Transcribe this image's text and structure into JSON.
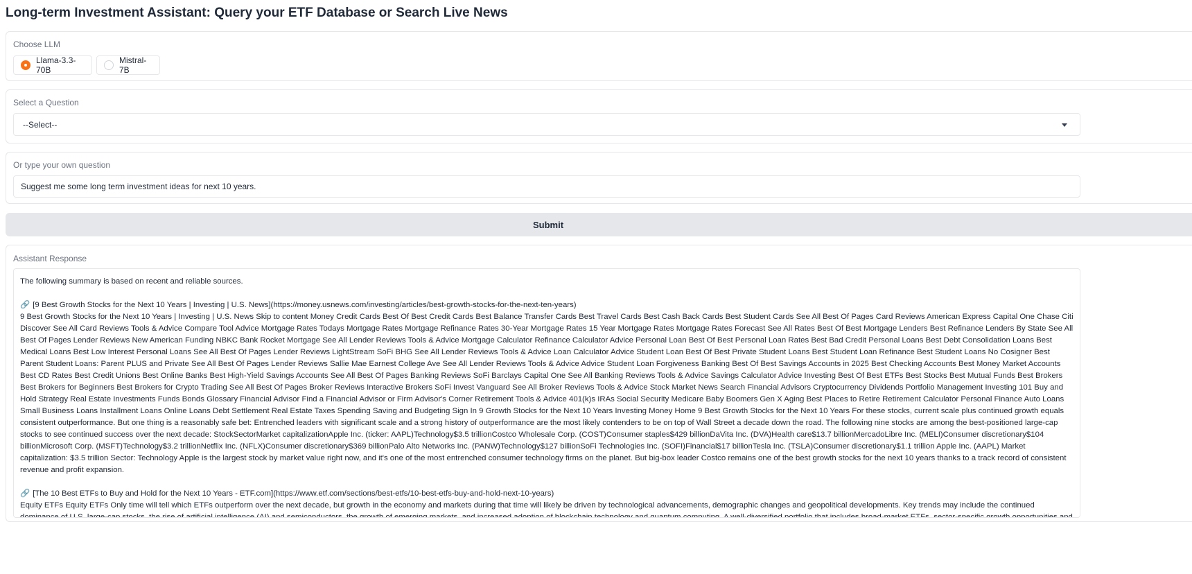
{
  "app": {
    "title": "Long-term Investment Assistant: Query your ETF Database or Search Live News"
  },
  "llm": {
    "label": "Choose LLM",
    "options": [
      {
        "label": "Llama-3.3-70B",
        "selected": true
      },
      {
        "label": "Mistral-7B",
        "selected": false
      }
    ]
  },
  "question_select": {
    "label": "Select a Question",
    "value": "--Select--"
  },
  "own_question": {
    "label": "Or type your own question",
    "value": "Suggest me some long term investment ideas for next 10 years."
  },
  "submit": {
    "label": "Submit"
  },
  "response": {
    "label": "Assistant Response",
    "intro": "The following summary is based on recent and reliable sources.",
    "sources": [
      {
        "icon": "link-icon",
        "title": "[9 Best Growth Stocks for the Next 10 Years | Investing | U.S. News](https://money.usnews.com/investing/articles/best-growth-stocks-for-the-next-ten-years)",
        "body": "9 Best Growth Stocks for the Next 10 Years | Investing | U.S. News Skip to content Money Credit Cards Best Of Best Credit Cards Best Balance Transfer Cards Best Travel Cards Best Cash Back Cards Best Student Cards See All Best Of Pages Card Reviews American Express Capital One Chase Citi Discover See All Card Reviews Tools & Advice Compare Tool Advice Mortgage Rates Todays Mortgage Rates Mortgage Refinance Rates 30-Year Mortgage Rates 15 Year Mortgage Rates Mortgage Rates Forecast See All Rates Best Of Best Mortgage Lenders Best Refinance Lenders By State See All Best Of Pages Lender Reviews New American Funding NBKC Bank Rocket Mortgage See All Lender Reviews Tools & Advice Mortgage Calculator Refinance Calculator Advice Personal Loan Best Of Best Personal Loan Rates Best Bad Credit Personal Loans Best Debt Consolidation Loans Best Medical Loans Best Low Interest Personal Loans See All Best Of Pages Lender Reviews LightStream SoFi BHG See All Lender Reviews Tools & Advice Loan Calculator Advice Student Loan Best Of Best Private Student Loans Best Student Loan Refinance Best Student Loans No Cosigner Best Parent Student Loans: Parent PLUS and Private See All Best Of Pages Lender Reviews Sallie Mae Earnest College Ave See All Lender Reviews Tools & Advice Advice Student Loan Forgiveness Banking Best Of Best Savings Accounts in 2025 Best Checking Accounts Best Money Market Accounts Best CD Rates Best Credit Unions Best Online Banks Best High-Yield Savings Accounts See All Best Of Pages Banking Reviews SoFi Barclays Capital One See All Banking Reviews Tools & Advice Savings Calculator Advice Investing Best Of Best ETFs Best Stocks Best Mutual Funds Best Brokers Best Brokers for Beginners Best Brokers for Crypto Trading See All Best Of Pages Broker Reviews Interactive Brokers SoFi Invest Vanguard See All Broker Reviews Tools & Advice Stock Market News Search Financial Advisors Cryptocurrency Dividends Portfolio Management Investing 101 Buy and Hold Strategy Real Estate Investments Funds Bonds Glossary Financial Advisor Find a Financial Advisor or Firm Advisor's Corner Retirement Tools & Advice 401(k)s IRAs Social Security Medicare Baby Boomers Gen X Aging Best Places to Retire Retirement Calculator Personal Finance Auto Loans Small Business Loans Installment Loans Online Loans Debt Settlement Real Estate Taxes Spending Saving and Budgeting Sign In 9 Growth Stocks for the Next 10 Years Investing Money Home 9 Best Growth Stocks for the Next 10 Years For these stocks, current scale plus continued growth equals consistent outperformance. But one thing is a reasonably safe bet: Entrenched leaders with significant scale and a strong history of outperformance are the most likely contenders to be on top of Wall Street a decade down the road. The following nine stocks are among the best-positioned large-cap stocks to see continued success over the next decade: StockSectorMarket capitalizationApple Inc. (ticker: AAPL)Technology$3.5 trillionCostco Wholesale Corp. (COST)Consumer staples$429 billionDaVita Inc. (DVA)Health care$13.7 billionMercadoLibre Inc. (MELI)Consumer discretionary$104 billionMicrosoft Corp. (MSFT)Technology$3.2 trillionNetflix Inc. (NFLX)Consumer discretionary$369 billionPalo Alto Networks Inc. (PANW)Technology$127 billionSoFi Technologies Inc. (SOFI)Financial$17 billionTesla Inc. (TSLA)Consumer discretionary$1.1 trillion Apple Inc. (AAPL) Market capitalization: $3.5 trillion Sector: Technology Apple is the largest stock by market value right now, and it's one of the most entrenched consumer technology firms on the planet. But big-box leader Costco remains one of the best growth stocks for the next 10 years thanks to a track record of consistent revenue and profit expansion."
      },
      {
        "icon": "link-icon",
        "title": "[The 10 Best ETFs to Buy and Hold for the Next 10 Years - ETF.com](https://www.etf.com/sections/best-etfs/10-best-etfs-buy-and-hold-next-10-years)",
        "body": "Equity ETFs Equity ETFs Only time will tell which ETFs outperform over the next decade, but growth in the economy and markets during that time will likely be driven by technological advancements, demographic changes and geopolitical developments. Key trends may include the continued dominance of U.S. large-cap stocks, the rise of artificial intelligence (AI) and semiconductors, the growth of emerging markets, and increased adoption of blockchain technology and quantum computing. A well-diversified portfolio that includes broad-market ETFs, sector-specific growth opportunities and thematic investments can help investors maximize long-term returns while managing risk. | Contact: kent.thune@etf.com Kent Thune is Senior Content Editor for etf.com, focusing on educational content, thought leadership, content management and search engine optimization (SEO). Money Market ETFs"
      }
    ]
  }
}
